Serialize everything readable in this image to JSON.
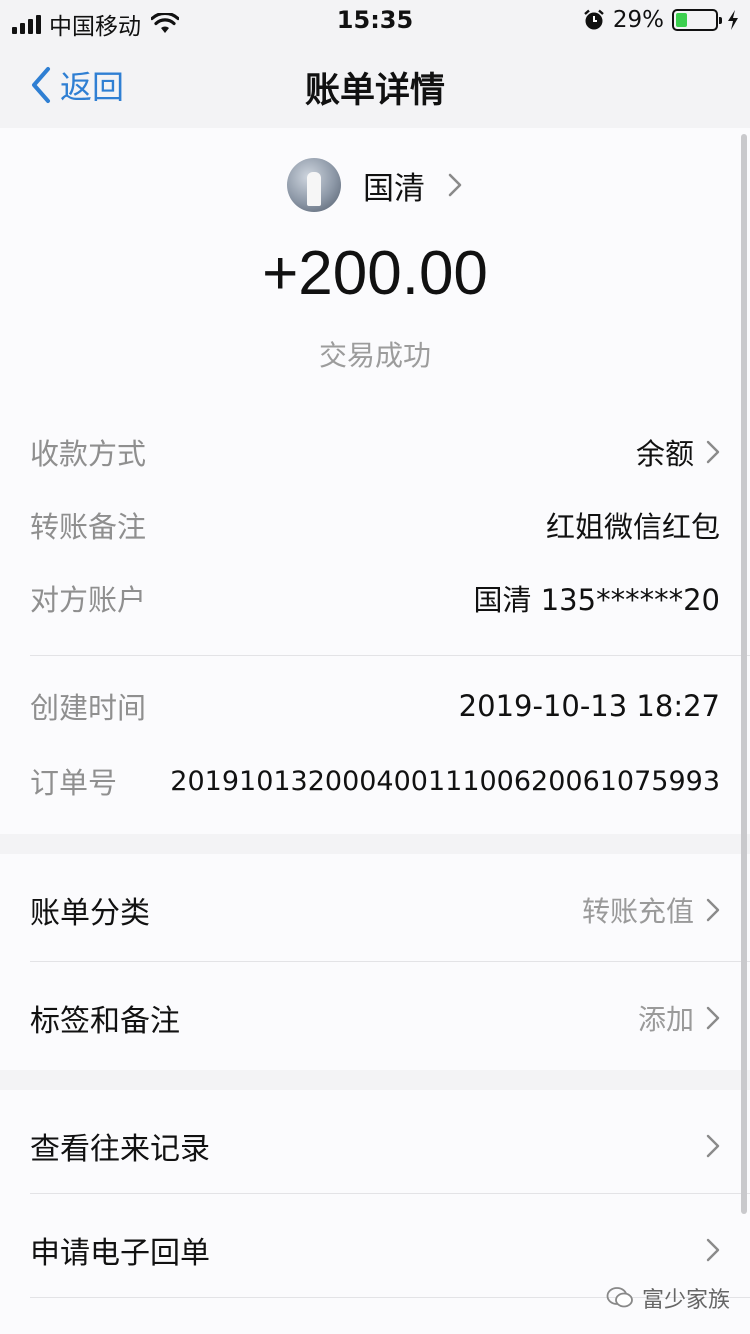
{
  "status_bar": {
    "carrier": "中国移动",
    "time": "15:35",
    "battery": "29%",
    "battery_level": 0.29
  },
  "nav": {
    "back_label": "返回",
    "title": "账单详情"
  },
  "header": {
    "name": "国清",
    "amount": "+200.00",
    "status": "交易成功"
  },
  "details": [
    {
      "label": "收款方式",
      "value": "余额"
    },
    {
      "label": "转账备注",
      "value": "红姐微信红包"
    },
    {
      "label": "对方账户",
      "value": "国清 135******20"
    },
    {
      "label": "创建时间",
      "value": "2019-10-13 18:27"
    },
    {
      "label": "订单号",
      "value": "20191013200040011100620061075993"
    }
  ],
  "section1": [
    {
      "label": "账单分类",
      "value": "转账充值"
    },
    {
      "label": "标签和备注",
      "value": "添加"
    }
  ],
  "section2": [
    {
      "label": "查看往来记录"
    },
    {
      "label": "申请电子回单"
    }
  ],
  "watermark": "富少家族",
  "colors": {
    "accent": "#2f7fd3",
    "battery_green": "#3ccf4e",
    "background": "#f3f3f5",
    "panel": "#fbfbfd"
  }
}
